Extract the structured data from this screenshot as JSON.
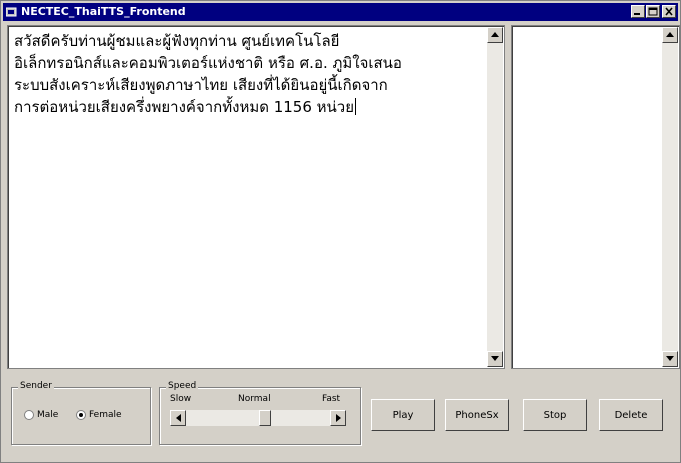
{
  "window": {
    "title": "NECTEC_ThaiTTS_Frontend",
    "controls": [
      "minimize-icon",
      "maximize-icon",
      "close-icon"
    ]
  },
  "editor": {
    "lines": [
      "สวัสดีครับท่านผู้ชมและผู้ฟังทุกท่าน ศูนย์เทคโนโลยี",
      "อิเล็กทรอนิกส์และคอมพิวเตอร์แห่งชาติ หรือ ศ.อ. ภูมิใจเสนอ",
      "ระบบสังเคราะห์เสียงพูดภาษาไทย เสียงที่ได้ยินอยู่นี้เกิดจาก",
      "การต่อหน่วยเสียงครึ่งพยางค์จากทั้งหมด 1156 หน่วย"
    ]
  },
  "sender": {
    "legend": "Sender",
    "male_label": "Male",
    "female_label": "Female",
    "selected": "Female"
  },
  "speed": {
    "legend": "Speed",
    "slow_label": "Slow",
    "normal_label": "Normal",
    "fast_label": "Fast",
    "value": 0.55
  },
  "buttons": {
    "play": "Play",
    "phonesx": "PhoneSx",
    "stop": "Stop",
    "delete": "Delete"
  },
  "colors": {
    "titlebar": "#000080",
    "face": "#d4d0c8"
  }
}
